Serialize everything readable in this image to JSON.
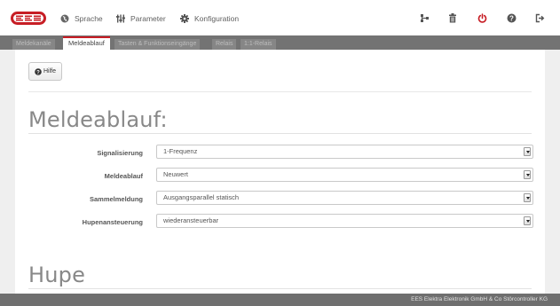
{
  "app": {
    "logo_text": "EES",
    "brand_color": "#c71e25"
  },
  "topnav": {
    "items": [
      {
        "label": "Sprache",
        "icon": "globe-icon"
      },
      {
        "label": "Parameter",
        "icon": "sliders-icon"
      },
      {
        "label": "Konfiguration",
        "icon": "gear-icon"
      }
    ],
    "tools": [
      {
        "icon": "network-icon"
      },
      {
        "icon": "trash-icon"
      },
      {
        "icon": "power-icon",
        "color": "#c71e25"
      },
      {
        "icon": "help-icon"
      },
      {
        "icon": "logout-icon"
      }
    ]
  },
  "tabs": [
    {
      "label": "Meldekanäle",
      "active": false
    },
    {
      "label": "Meldeablauf",
      "active": true
    },
    {
      "label": "Tasten & Funktionseingänge",
      "active": false
    },
    {
      "label": "Relais",
      "active": false
    },
    {
      "label": "1:1-Relais",
      "active": false
    }
  ],
  "help_button": {
    "label": "Hilfe"
  },
  "section1": {
    "title": "Meldeablauf:",
    "fields": [
      {
        "label": "Signalisierung",
        "value": "1-Frequenz"
      },
      {
        "label": "Meldeablauf",
        "value": "Neuwert"
      },
      {
        "label": "Sammelmeldung",
        "value": "Ausgangsparallel statisch"
      },
      {
        "label": "Hupenansteuerung",
        "value": "wiederansteuerbar"
      }
    ]
  },
  "section2": {
    "title": "Hupe"
  },
  "footer": {
    "text": "EES Elektra Elektronik GmbH & Co Störcontroller KG"
  }
}
